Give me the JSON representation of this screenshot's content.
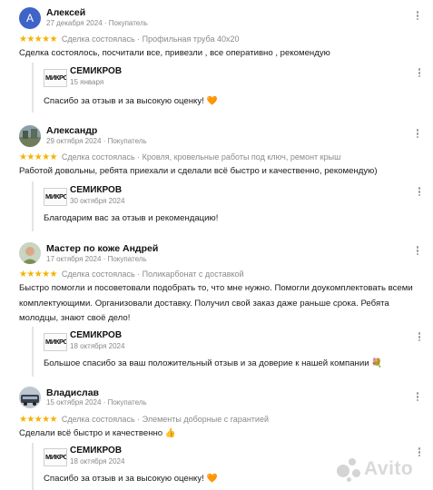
{
  "reviews": [
    {
      "avatar_letter": "А",
      "name": "Алексей",
      "date": "27 декабря 2024",
      "role": "Покупатель",
      "stars": "★★★★★",
      "deal_status": "Сделка состоялась",
      "product": "Профильная труба 40х20",
      "text": "Сделка состоялось, посчитали все, привезли , все оперативно , рекомендую",
      "reply": {
        "logo_text": "МИКРО",
        "name": "СЕМИКРОВ",
        "date": "15 января",
        "text": "Спасибо за отзыв и за высокую оценку! 🧡"
      }
    },
    {
      "name": "Александр",
      "date": "29 октября 2024",
      "role": "Покупатель",
      "stars": "★★★★★",
      "deal_status": "Сделка состоялась",
      "product": "Кровля, кровельные работы под ключ, ремонт крыш",
      "text": "Работой довольны, ребята приехали и сделали всё быстро и качественно, рекомендую)",
      "reply": {
        "logo_text": "МИКРО",
        "name": "СЕМИКРОВ",
        "date": "30 октября 2024",
        "text": "Благодарим вас за отзыв и рекомендацию!"
      }
    },
    {
      "name": "Мастер по коже Андрей",
      "date": "17 октября 2024",
      "role": "Покупатель",
      "stars": "★★★★★",
      "deal_status": "Сделка состоялась",
      "product": "Поликарбонат с доставкой",
      "text": "Быстро помогли и посоветовали подобрать то, что мне нужно. Помогли доукомплектовать всеми комплектующими. Организовали доставку. Получил свой заказ даже раньше срока. Ребята молодцы, знают своё дело!",
      "reply": {
        "logo_text": "МИКРО",
        "name": "СЕМИКРОВ",
        "date": "18 октября 2024",
        "text": "Большое спасибо за ваш положительный отзыв и за доверие к нашей компании 💐"
      }
    },
    {
      "name": "Владислав",
      "date": "15 октября 2024",
      "role": "Покупатель",
      "stars": "★★★★★",
      "deal_status": "Сделка состоялась",
      "product": "Элементы доборные с гарантией",
      "text": "Сделали всё быстро и качественно 👍",
      "reply": {
        "logo_text": "МИКРО",
        "name": "СЕМИКРОВ",
        "date": "18 октября 2024",
        "text": "Спасибо за отзыв и за высокую оценку! 🧡"
      }
    }
  ],
  "separator": "·",
  "watermark": "Avito",
  "colors": {
    "star": "#f5b200",
    "avatar_letter_bg": "#3f64c7",
    "muted_text": "#888888"
  }
}
